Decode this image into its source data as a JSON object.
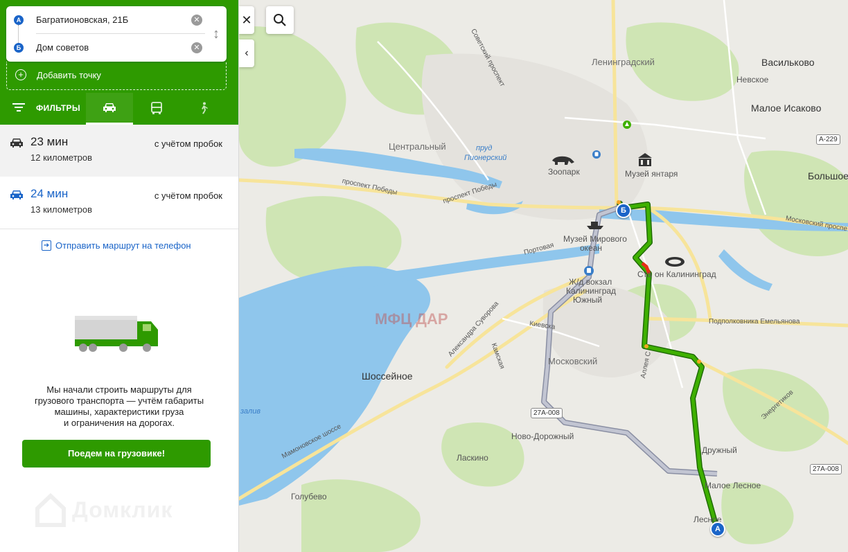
{
  "route_points": {
    "from": {
      "badge": "А",
      "value": "Багратионовская, 21Б"
    },
    "to": {
      "badge": "Б",
      "value": "Дом советов"
    },
    "add_label": "Добавить точку"
  },
  "modes": {
    "filters_label": "ФИЛЬТРЫ",
    "items": [
      {
        "name": "car",
        "icon": "car-icon",
        "active": true
      },
      {
        "name": "transit",
        "icon": "bus-icon",
        "active": false
      },
      {
        "name": "walk",
        "icon": "pedestrian-icon",
        "active": false
      }
    ]
  },
  "routes": [
    {
      "time": "23 мин",
      "distance": "12 километров",
      "traffic": "с учётом пробок"
    },
    {
      "time": "24 мин",
      "distance": "13 километров",
      "traffic": "с учётом пробок"
    }
  ],
  "send_to_phone": "Отправить маршрут на телефон",
  "promo": {
    "lines": [
      "Мы начали строить маршруты для",
      "грузового транспорта — учтём габариты",
      "машины, характеристики груза",
      "и ограничения на дорогах."
    ],
    "button": "Поедем на грузовике!"
  },
  "brand": "Домклик",
  "map": {
    "districts": [
      "Ленинградский",
      "Центральный",
      "Московский"
    ],
    "places": [
      "Васильково",
      "Невское",
      "Малое Исаково",
      "Большое",
      "Шоссейное",
      "Ново-Дорожный",
      "Ласкино",
      "Голубево",
      "Малое Лесное",
      "Лесное",
      "Дружный"
    ],
    "water": [
      "пруд Пионерский",
      "Калининградский залив"
    ],
    "water_lines": [
      "пруд",
      "Пионерский",
      "залив"
    ],
    "roads": [
      "Советский проспект",
      "проспект Победы",
      "Портовая",
      "улица Александра Суворова",
      "Камская",
      "Киевская",
      "Мамоновское шоссе",
      "Аллея Смелых",
      "Подполковника Емельянова",
      "Энергетиков",
      "Московский проспект"
    ],
    "road_labels": [
      "Советский проспект",
      "проспект Победы",
      "проспект Победы",
      "Портовая",
      "Александра Суворова",
      "Камская",
      "Киевска",
      "Мамоновское шоссе",
      "Аллея С",
      "Подполковника Емельянова",
      "Энергетиков",
      "Московский проспе"
    ],
    "pois": [
      "Зоопарк",
      "Музей янтаря",
      "Музей Мирового океана",
      "Ж/д вокзал Калининград Южный",
      "Стадион Калининград"
    ],
    "poi_lines": [
      "Музей Мирового",
      "океан",
      "Ж/д вокзал",
      "Калининград",
      "Южный",
      "Ста",
      "он Калининград"
    ],
    "shields": [
      "A-229",
      "27A-008",
      "27A-008"
    ],
    "watermark": "МФЦ ДАР",
    "watermark_visible": "МФЦ ДАР"
  },
  "colors": {
    "brand_green": "#2e9a00",
    "route_primary": "#2e9a00",
    "route_alt": "#a7aab8",
    "marker_blue": "#1a64c8"
  }
}
